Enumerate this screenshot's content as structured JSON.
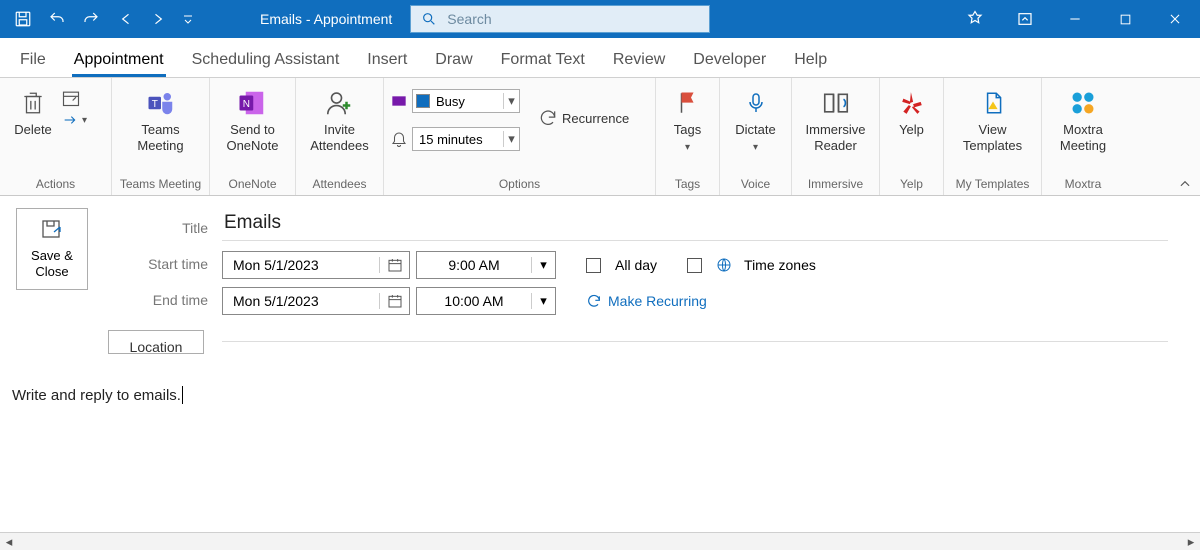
{
  "titlebar": {
    "title": "Emails  -  Appointment",
    "search_placeholder": "Search"
  },
  "tabs": [
    "File",
    "Appointment",
    "Scheduling Assistant",
    "Insert",
    "Draw",
    "Format Text",
    "Review",
    "Developer",
    "Help"
  ],
  "active_tab": "Appointment",
  "ribbon": {
    "actions": {
      "label": "Actions",
      "delete": "Delete"
    },
    "teams": {
      "label": "Teams Meeting",
      "btn": "Teams\nMeeting"
    },
    "onenote": {
      "label": "OneNote",
      "btn": "Send to\nOneNote"
    },
    "attendees": {
      "label": "Attendees",
      "btn": "Invite\nAttendees"
    },
    "options": {
      "label": "Options",
      "show_as": "Busy",
      "reminder": "15 minutes",
      "recurrence": "Recurrence"
    },
    "tags": {
      "label": "Tags",
      "btn": "Tags"
    },
    "voice": {
      "label": "Voice",
      "btn": "Dictate"
    },
    "immersive": {
      "label": "Immersive",
      "btn": "Immersive\nReader"
    },
    "yelp": {
      "label": "Yelp",
      "btn": "Yelp"
    },
    "templates": {
      "label": "My Templates",
      "btn": "View\nTemplates"
    },
    "moxtra": {
      "label": "Moxtra",
      "btn": "Moxtra\nMeeting"
    }
  },
  "form": {
    "save_close": "Save &\nClose",
    "labels": {
      "title": "Title",
      "start": "Start time",
      "end": "End time",
      "location": "Location"
    },
    "title_value": "Emails",
    "start_date": "Mon 5/1/2023",
    "start_time": "9:00 AM",
    "end_date": "Mon 5/1/2023",
    "end_time": "10:00 AM",
    "all_day": "All day",
    "time_zones": "Time zones",
    "make_recurring": "Make Recurring"
  },
  "body_text": "Write and reply to emails."
}
